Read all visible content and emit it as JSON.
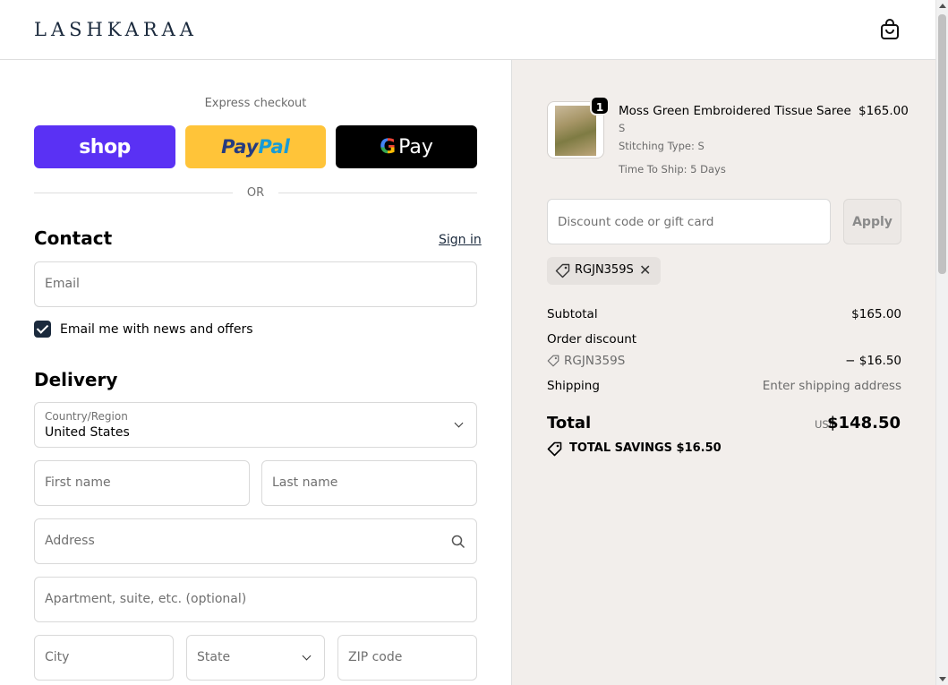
{
  "header": {
    "logo": "LASHKARAA",
    "cart_icon": "shopping-bag-icon"
  },
  "express": {
    "label": "Express checkout",
    "shop_label": "shop",
    "paypal_part1": "Pay",
    "paypal_part2": "Pal",
    "gpay_g": "G",
    "gpay_label": "Pay",
    "or": "OR"
  },
  "contact": {
    "title": "Contact",
    "signin": "Sign in",
    "email_placeholder": "Email",
    "newsletter_label": "Email me with news and offers",
    "newsletter_checked": true
  },
  "delivery": {
    "title": "Delivery",
    "country_label": "Country/Region",
    "country_value": "United States",
    "first_name": "First name",
    "last_name": "Last name",
    "address": "Address",
    "apartment": "Apartment, suite, etc. (optional)",
    "city": "City",
    "state": "State",
    "zip": "ZIP code"
  },
  "order": {
    "item": {
      "quantity": "1",
      "name": "Moss Green Embroidered Tissue Saree",
      "price": "$165.00",
      "variant": "S",
      "stitching": "Stitching Type: S",
      "ship_time": "Time To Ship: 5 Days"
    },
    "discount_placeholder": "Discount code or gift card",
    "apply_label": "Apply",
    "applied_code": "RGJN359S",
    "subtotal_label": "Subtotal",
    "subtotal_value": "$165.00",
    "order_discount_label": "Order discount",
    "discount_code": "RGJN359S",
    "discount_value": "− $16.50",
    "shipping_label": "Shipping",
    "shipping_value": "Enter shipping address",
    "total_label": "Total",
    "currency": "USD",
    "total_value": "$148.50",
    "savings_label": "TOTAL SAVINGS  $16.50"
  },
  "colors": {
    "accent": "#1b2a3d",
    "shop": "#5a31f4",
    "paypal": "#ffc439",
    "summary_bg": "#f2eeeb"
  }
}
